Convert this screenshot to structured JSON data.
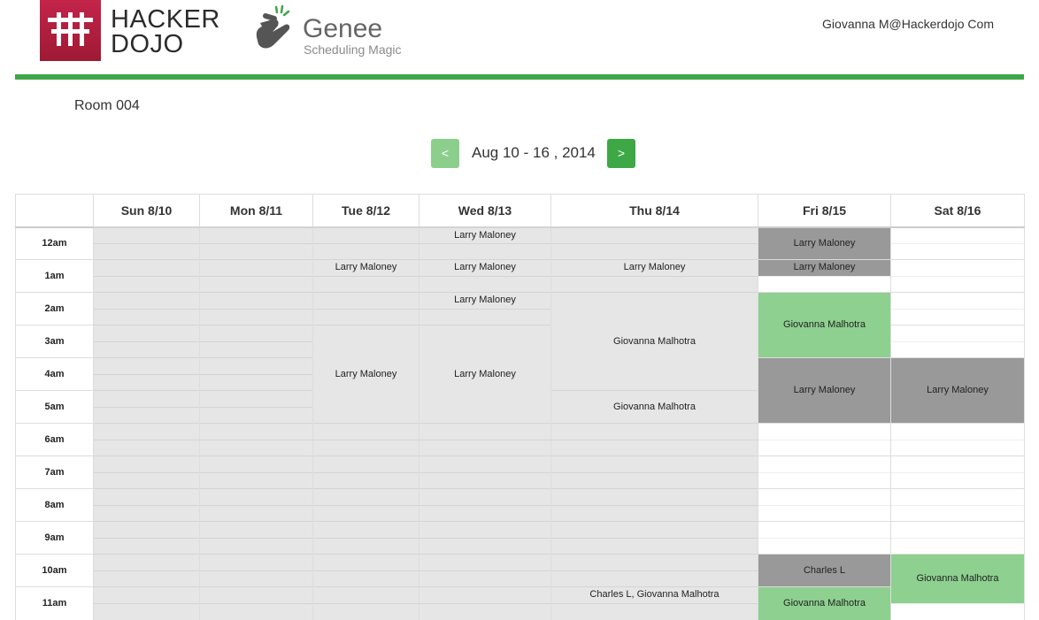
{
  "header": {
    "brand_line1": "HACKER",
    "brand_line2": "DOJO",
    "product_name": "Genee",
    "product_tagline": "Scheduling Magic",
    "user": "Giovanna M@Hackerdojo Com",
    "accent_color": "#3fa548",
    "brand_color": "#b11f3c",
    "logo_icon": "hacker-dojo-logo-icon",
    "product_icon": "snapping-fingers-icon"
  },
  "room": "Room 004",
  "nav": {
    "prev": "<",
    "next": ">",
    "range": "Aug 10 - 16 , 2014"
  },
  "calendar": {
    "days": [
      "Sun 8/10",
      "Mon 8/11",
      "Tue 8/12",
      "Wed 8/13",
      "Thu 8/14",
      "Fri 8/15",
      "Sat 8/16"
    ],
    "hours": [
      "12am",
      "1am",
      "2am",
      "3am",
      "4am",
      "5am",
      "6am",
      "7am",
      "8am",
      "9am",
      "10am",
      "11am"
    ],
    "status_colors": {
      "unavailable": "#e6e6e6",
      "booked_other": "#999999",
      "booked_mine": "#8dd08f",
      "free": "#ffffff"
    },
    "events": [
      {
        "day": "Tue 8/12",
        "start": "1am",
        "end": "1:30am",
        "name": "Larry Maloney",
        "status": "unavailable"
      },
      {
        "day": "Tue 8/12",
        "start": "3am",
        "end": "6am",
        "name": "Larry Maloney",
        "status": "unavailable"
      },
      {
        "day": "Wed 8/13",
        "start": "12am",
        "end": "12:30am",
        "name": "Larry Maloney",
        "status": "unavailable"
      },
      {
        "day": "Wed 8/13",
        "start": "1am",
        "end": "1:30am",
        "name": "Larry Maloney",
        "status": "unavailable"
      },
      {
        "day": "Wed 8/13",
        "start": "2am",
        "end": "2:30am",
        "name": "Larry Maloney",
        "status": "unavailable"
      },
      {
        "day": "Wed 8/13",
        "start": "3am",
        "end": "6am",
        "name": "Larry Maloney",
        "status": "unavailable"
      },
      {
        "day": "Thu 8/14",
        "start": "1am",
        "end": "1:30am",
        "name": "Larry Maloney",
        "status": "unavailable"
      },
      {
        "day": "Thu 8/14",
        "start": "2am",
        "end": "5am",
        "name": "Giovanna Malhotra",
        "status": "unavailable"
      },
      {
        "day": "Thu 8/14",
        "start": "5am",
        "end": "6am",
        "name": "Giovanna Malhotra",
        "status": "unavailable"
      },
      {
        "day": "Thu 8/14",
        "start": "11am",
        "end": "11:30am",
        "name": "Charles L, Giovanna Malhotra",
        "status": "unavailable"
      },
      {
        "day": "Fri 8/15",
        "start": "12am",
        "end": "1am",
        "name": "Larry Maloney",
        "status": "booked_other"
      },
      {
        "day": "Fri 8/15",
        "start": "1am",
        "end": "1:30am",
        "name": "Larry Maloney",
        "status": "booked_other"
      },
      {
        "day": "Fri 8/15",
        "start": "2am",
        "end": "4am",
        "name": "Giovanna Malhotra",
        "status": "booked_mine"
      },
      {
        "day": "Fri 8/15",
        "start": "4am",
        "end": "6am",
        "name": "Larry Maloney",
        "status": "booked_other"
      },
      {
        "day": "Fri 8/15",
        "start": "10am",
        "end": "11am",
        "name": "Charles L",
        "status": "booked_other"
      },
      {
        "day": "Fri 8/15",
        "start": "11am",
        "end": "12pm",
        "name": "Giovanna Malhotra",
        "status": "booked_mine"
      },
      {
        "day": "Sat 8/16",
        "start": "4am",
        "end": "6am",
        "name": "Larry Maloney",
        "status": "booked_other"
      },
      {
        "day": "Sat 8/16",
        "start": "10am",
        "end": "11:30am",
        "name": "Giovanna Malhotra",
        "status": "booked_mine"
      }
    ]
  }
}
